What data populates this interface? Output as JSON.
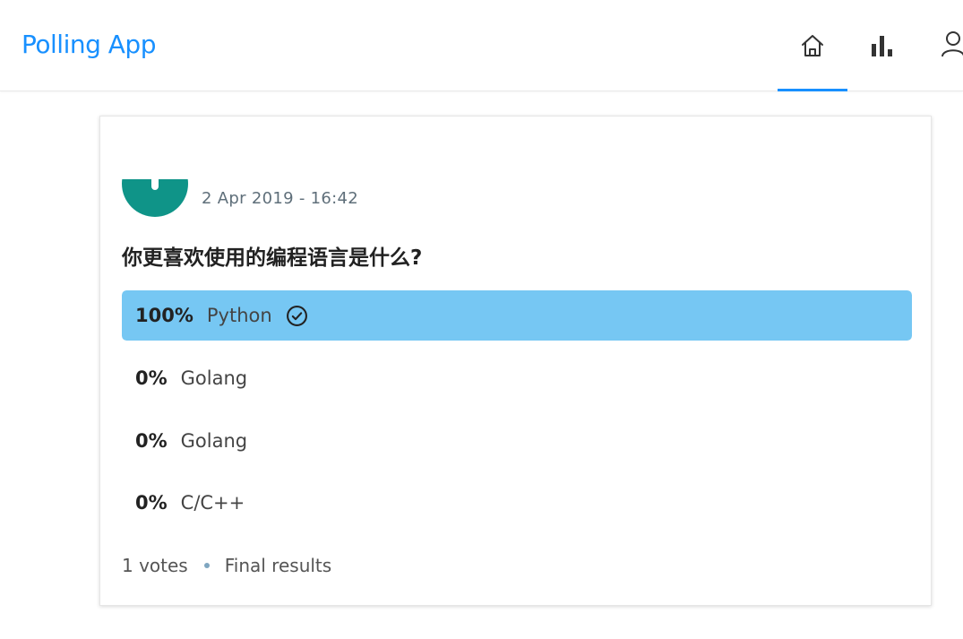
{
  "header": {
    "app_title": "Polling App",
    "nav": [
      {
        "name": "home",
        "icon": "home-icon",
        "active": true
      },
      {
        "name": "new-poll",
        "icon": "bar-chart-icon",
        "active": false
      },
      {
        "name": "profile",
        "icon": "user-icon",
        "active": false
      }
    ],
    "accent_color": "#1890ff"
  },
  "poll": {
    "avatar_color": "#0f9488",
    "created_at": "2 Apr 2019 - 16:42",
    "question": "你更喜欢使用的编程语言是什么?",
    "choices": [
      {
        "percent": "100%",
        "fraction": 1.0,
        "label": "Python",
        "selected": true
      },
      {
        "percent": "0%",
        "fraction": 0.0,
        "label": "Golang",
        "selected": false
      },
      {
        "percent": "0%",
        "fraction": 0.0,
        "label": "Golang",
        "selected": false
      },
      {
        "percent": "0%",
        "fraction": 0.0,
        "label": "C/C++",
        "selected": false
      }
    ],
    "winner_fill_color": "#76c7f3",
    "votes": "1 votes",
    "status": "Final results"
  }
}
